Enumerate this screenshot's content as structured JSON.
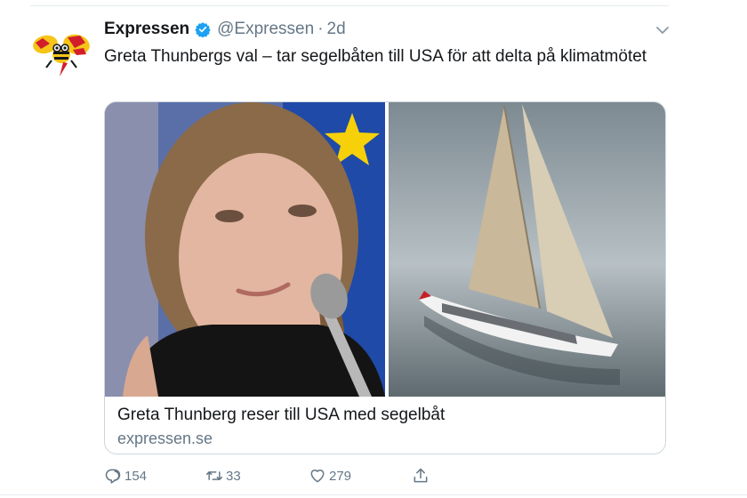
{
  "tweet": {
    "display_name": "Expressen",
    "handle": "@Expressen",
    "separator": "·",
    "timestamp": "2d",
    "text": "Greta Thunbergs val – tar segelbåten till USA för att delta på klimatmötet",
    "verified": true
  },
  "card": {
    "title": "Greta Thunberg reser till USA med segelbåt",
    "domain": "expressen.se"
  },
  "actions": {
    "reply_count": "154",
    "retweet_count": "33",
    "like_count": "279"
  },
  "icons": {
    "verified": "verified-badge-icon",
    "menu": "chevron-down-icon",
    "reply": "reply-icon",
    "retweet": "retweet-icon",
    "like": "heart-icon",
    "share": "share-icon"
  },
  "colors": {
    "verified_blue": "#1da1f2",
    "secondary_text": "#657786",
    "border": "#ccd6dd"
  }
}
